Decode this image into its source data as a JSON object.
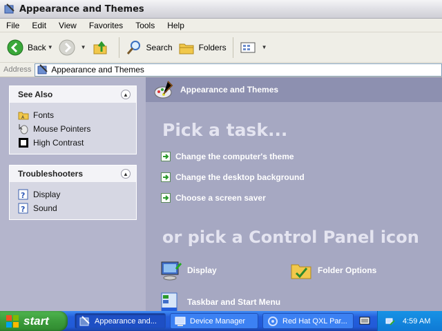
{
  "window": {
    "title": "Appearance and Themes"
  },
  "menu": [
    "File",
    "Edit",
    "View",
    "Favorites",
    "Tools",
    "Help"
  ],
  "toolbar": {
    "back": "Back",
    "search": "Search",
    "folders": "Folders"
  },
  "address": {
    "label": "Address",
    "value": "Appearance and Themes"
  },
  "see_also": {
    "title": "See Also",
    "items": [
      "Fonts",
      "Mouse Pointers",
      "High Contrast"
    ]
  },
  "troubleshooters": {
    "title": "Troubleshooters",
    "items": [
      "Display",
      "Sound"
    ]
  },
  "main": {
    "header": "Appearance and Themes",
    "pick_task": "Pick a task...",
    "tasks": [
      "Change the computer's theme",
      "Change the desktop background",
      "Choose a screen saver"
    ],
    "or_pick": "or pick a Control Panel icon",
    "icons": [
      "Display",
      "Folder Options",
      "Taskbar and Start Menu"
    ]
  },
  "taskbar": {
    "start": "start",
    "buttons": [
      "Appearance and...",
      "Device Manager",
      "Red Hat QXL Par..."
    ],
    "clock": "4:59 AM"
  },
  "colors": {
    "main_bg": "#a6a8c2",
    "left_bg": "#b4b5cc",
    "taskbar": "#245edb",
    "start": "#3c9c3c"
  }
}
